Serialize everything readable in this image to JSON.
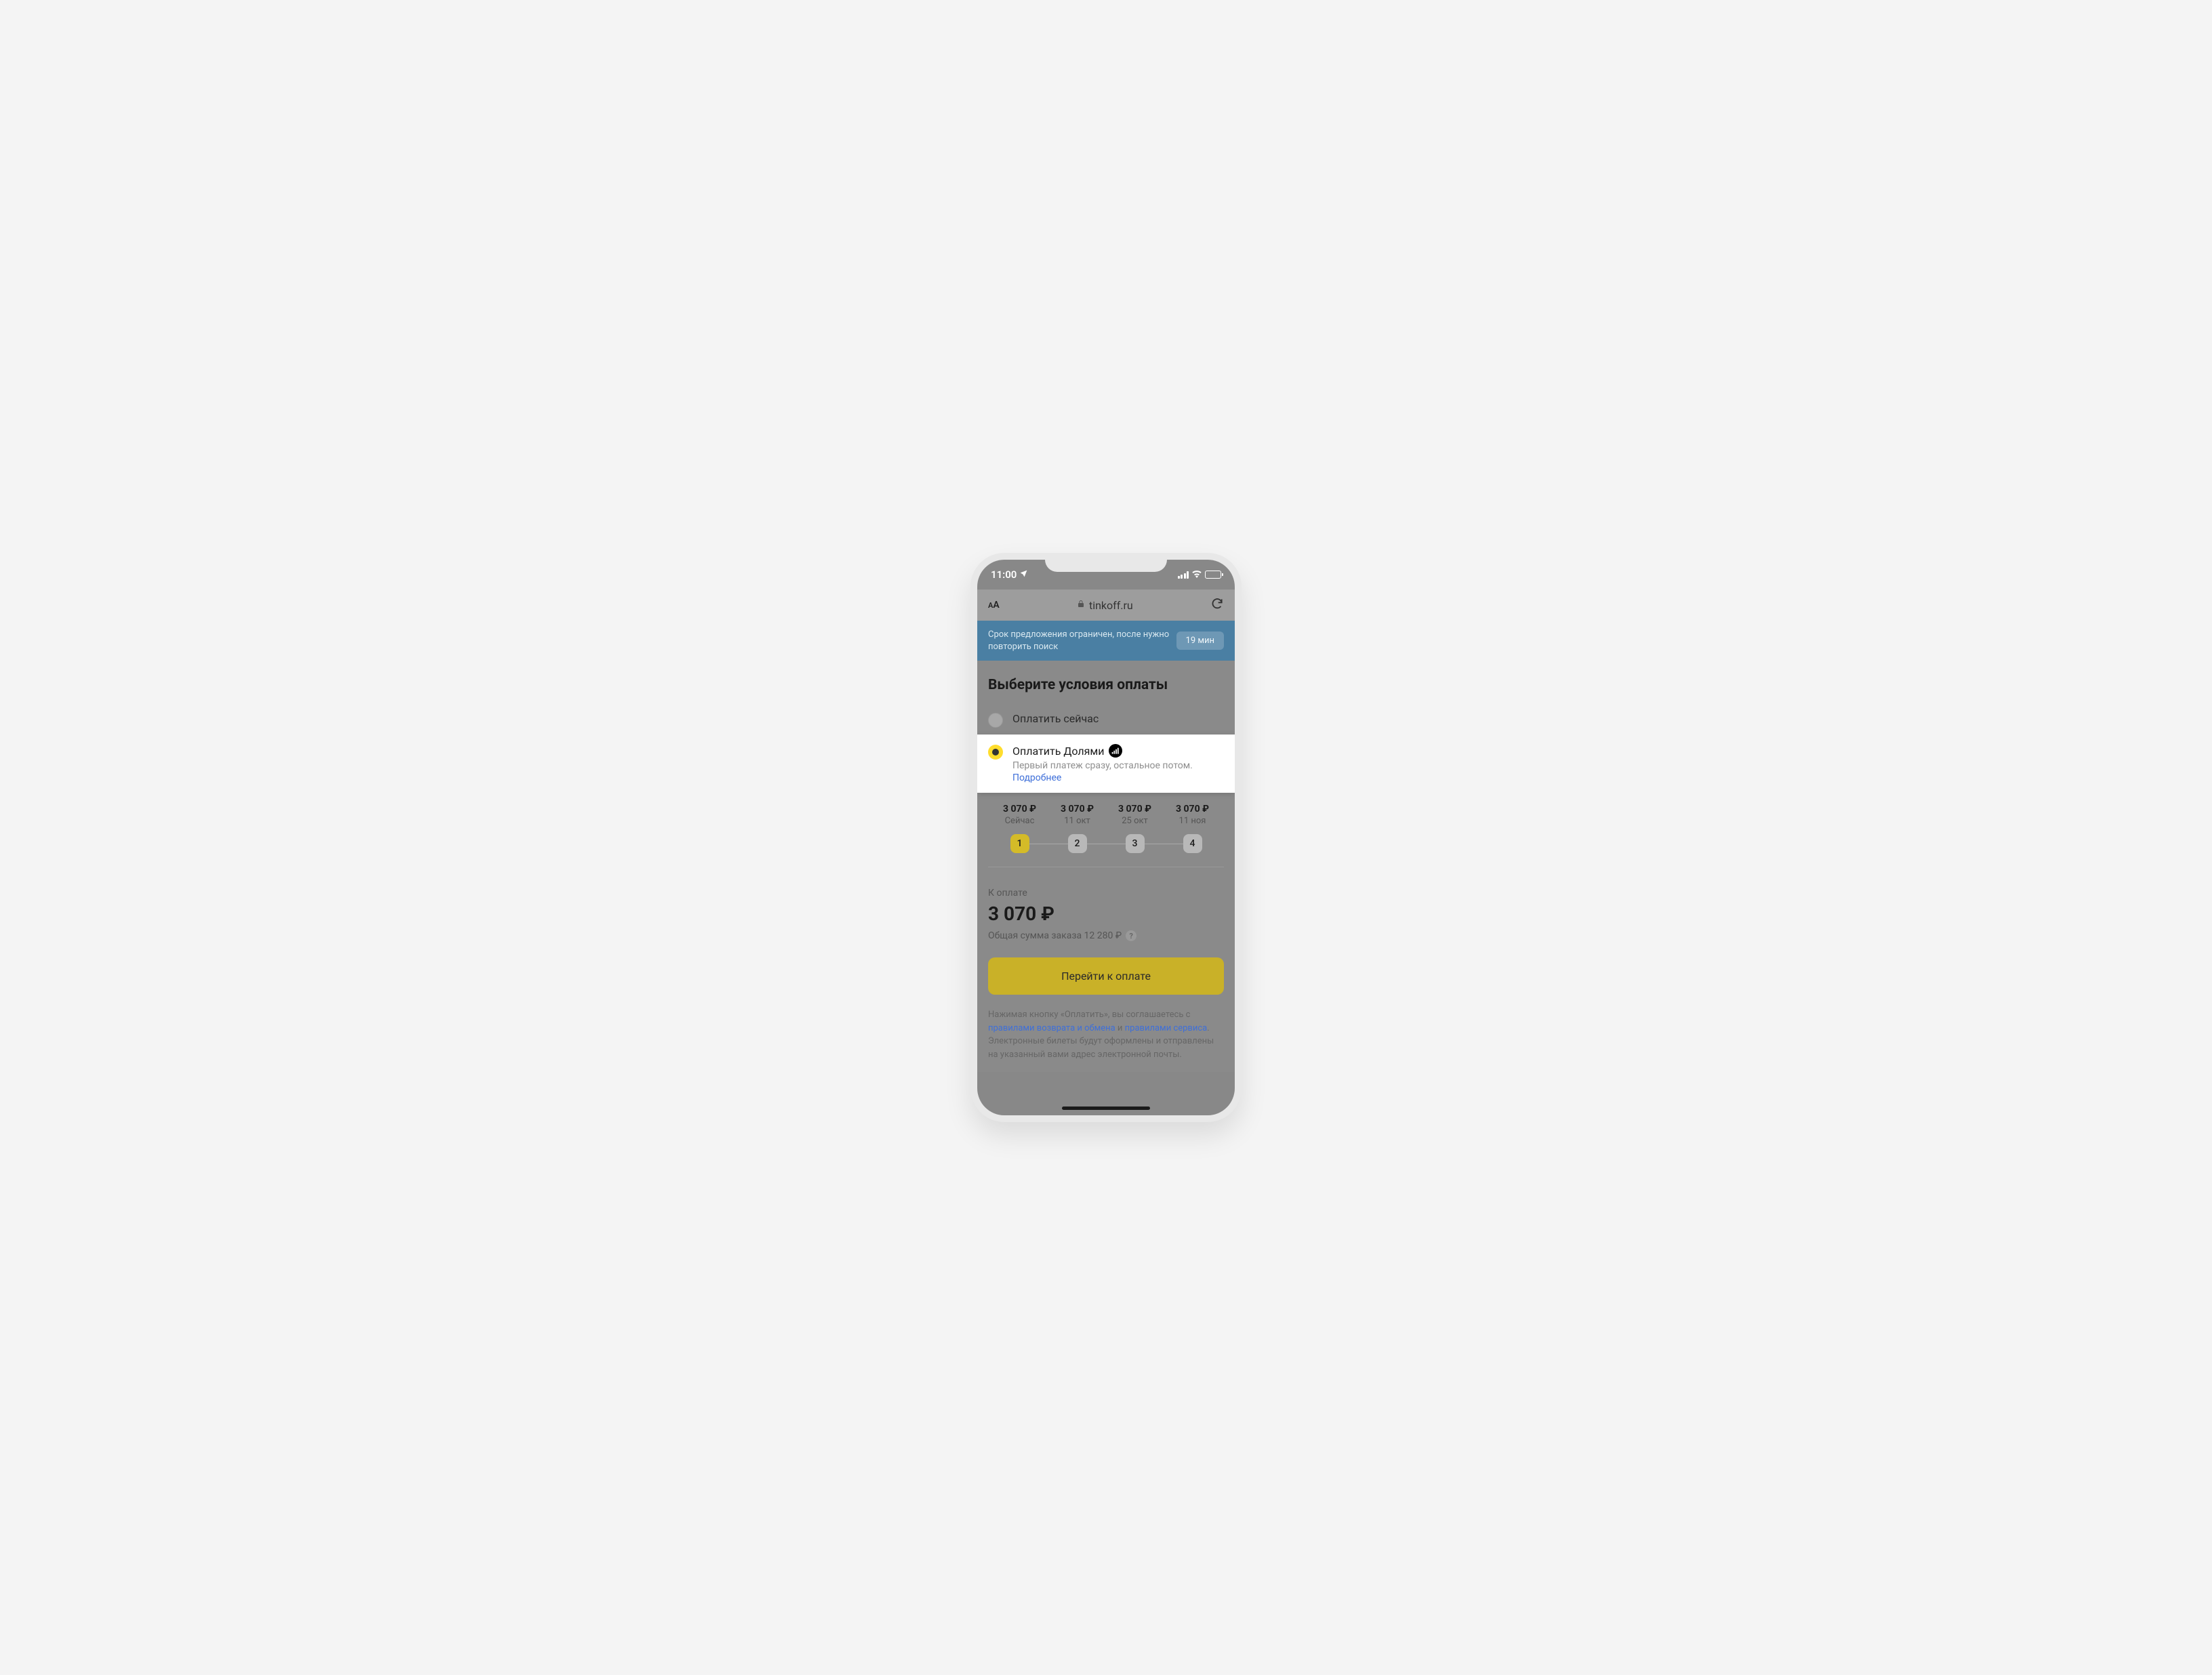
{
  "statusBar": {
    "time": "11:00"
  },
  "browser": {
    "url": "tinkoff.ru"
  },
  "banner": {
    "text": "Срок предложения ограничен, после нужно повторить поиск",
    "badge": "19 мин"
  },
  "heading": "Выберите условия оплаты",
  "payNow": {
    "label": "Оплатить сейчас"
  },
  "dolyami": {
    "title": "Оплатить Долями",
    "subtitle": "Первый платеж сразу, остальное потом.",
    "moreLink": "Подробнее"
  },
  "schedule": [
    {
      "amount": "3 070 ₽",
      "date": "Сейчас",
      "step": "1"
    },
    {
      "amount": "3 070 ₽",
      "date": "11 окт",
      "step": "2"
    },
    {
      "amount": "3 070 ₽",
      "date": "25 окт",
      "step": "3"
    },
    {
      "amount": "3 070 ₽",
      "date": "11 ноя",
      "step": "4"
    }
  ],
  "total": {
    "label": "К оплате",
    "amount": "3 070 ₽",
    "subPrefix": "Общая сумма заказа ",
    "subAmount": "12 280 ₽"
  },
  "payButton": "Перейти к оплате",
  "terms": {
    "t1": "Нажимая кнопку «Оплатить», вы соглашаетесь с ",
    "link1": "правилами возврата и обмена",
    "t2": " и ",
    "link2": "правилами сервиса",
    "t3": ". Электронные билеты будут оформлены и отправлены на указанный вами адрес электронной почты."
  }
}
